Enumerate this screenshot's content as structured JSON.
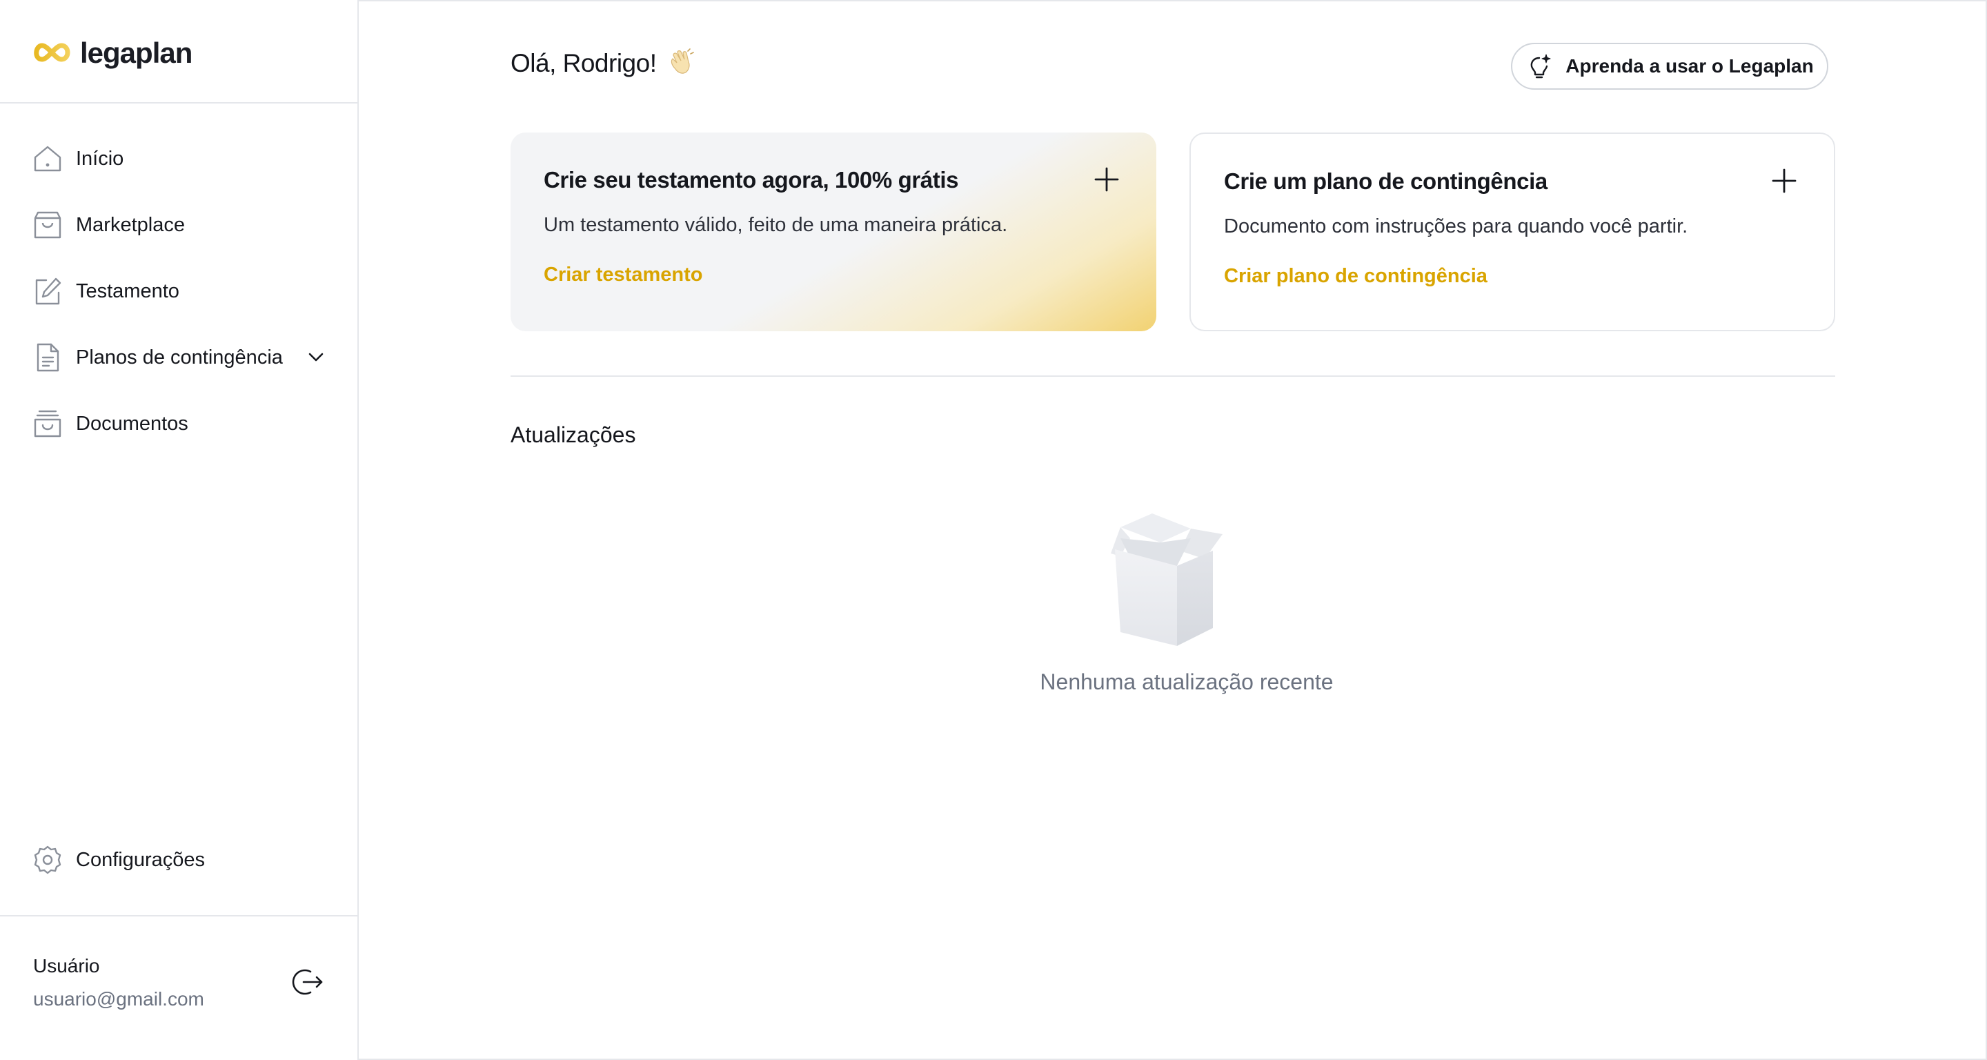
{
  "brand": {
    "name": "legaplan"
  },
  "sidebar": {
    "items": [
      {
        "label": "Início",
        "icon": "home-icon"
      },
      {
        "label": "Marketplace",
        "icon": "shopping-bag-icon"
      },
      {
        "label": "Testamento",
        "icon": "edit-icon"
      },
      {
        "label": "Planos de contingência",
        "icon": "document-icon",
        "expandable": true
      },
      {
        "label": "Documentos",
        "icon": "archive-icon"
      }
    ],
    "settings_label": "Configurações",
    "user": {
      "name": "Usuário",
      "email": "usuario@gmail.com"
    }
  },
  "header": {
    "greeting": "Olá, Rodrigo!",
    "greeting_emoji": "waving-hand-icon",
    "learn_button": "Aprenda a usar o Legaplan"
  },
  "cards": [
    {
      "title": "Crie seu testamento agora, 100% grátis",
      "description": "Um testamento válido, feito de uma maneira prática.",
      "link": "Criar testamento"
    },
    {
      "title": "Crie um plano de contingência",
      "description": "Documento com instruções para quando você partir.",
      "link": "Criar plano de contingência"
    }
  ],
  "updates": {
    "title": "Atualizações",
    "empty_text": "Nenhuma atualização recente"
  },
  "colors": {
    "accent": "#d9a400",
    "gradient_yellow": "#f2d272",
    "border": "#e5e7eb",
    "muted_text": "#6b7280"
  }
}
